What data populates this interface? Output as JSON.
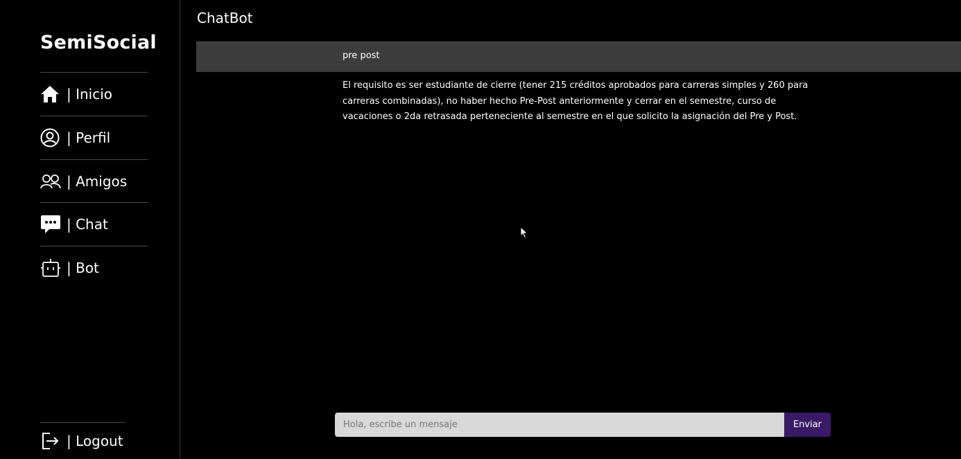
{
  "brand": "SemiSocial",
  "nav": {
    "inicio": "| Inicio",
    "perfil": "| Perfil",
    "amigos": "| Amigos",
    "chat": "| Chat",
    "bot": "| Bot",
    "logout": "| Logout"
  },
  "page": {
    "title": "ChatBot"
  },
  "messages": {
    "user": "pre post",
    "bot": "El requisito es ser estudiante de cierre (tener 215 créditos aprobados para carreras simples y 260 para carreras combinadas), no haber hecho Pre-Post anteriormente y cerrar en el semestre, curso de vacaciones o 2da retrasada perteneciente al semestre en el que solicito la asignación del Pre y Post."
  },
  "composer": {
    "placeholder": "Hola, escribe un mensaje",
    "value": "",
    "send_label": "Enviar"
  },
  "icons": {
    "inicio": "home-icon",
    "perfil": "user-circle-icon",
    "amigos": "users-icon",
    "chat": "chat-bubble-icon",
    "bot": "robot-icon",
    "logout": "logout-icon"
  },
  "colors": {
    "background": "#000000",
    "user_message_bg": "#3c3c3c",
    "send_button": "#3a1a66",
    "input_bg": "#d9d9d9"
  }
}
